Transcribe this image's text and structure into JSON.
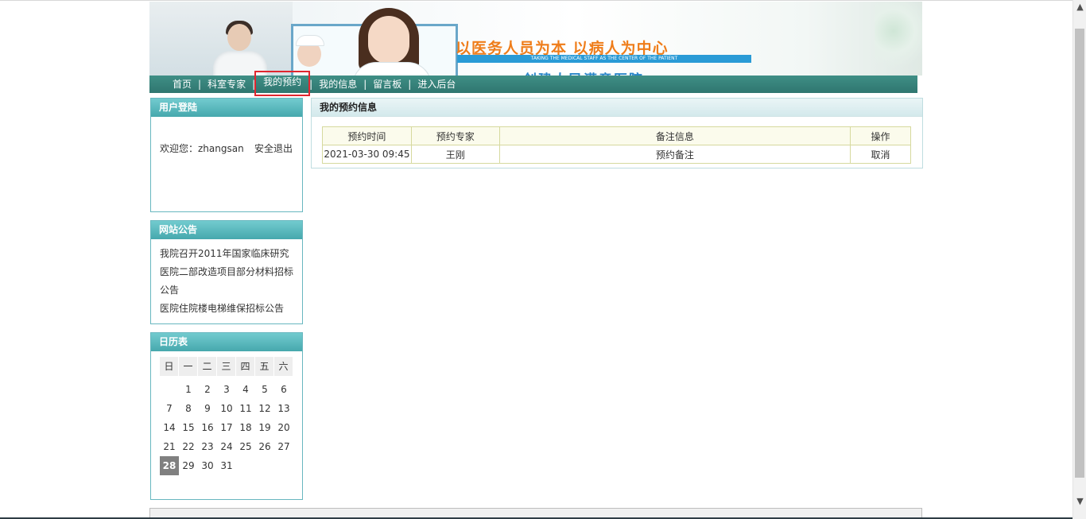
{
  "banner": {
    "slogan": "以医务人员为本 以病人为中心",
    "slogan_en": "TAKING THE MEDICAL STAFF AS THE CENTER OF THE PATIENT",
    "slogan_cut": "创建人民满意医院"
  },
  "nav": {
    "items": [
      {
        "label": "首页"
      },
      {
        "label": "科室专家"
      },
      {
        "label": "我的预约"
      },
      {
        "label": "我的信息"
      },
      {
        "label": "留言板"
      },
      {
        "label": "进入后台"
      }
    ],
    "separator": "|",
    "active_index": 2
  },
  "login": {
    "title": "用户登陆",
    "welcome": "欢迎您：zhangsan",
    "logout": "安全退出"
  },
  "notices": {
    "title": "网站公告",
    "items": [
      "我院召开2011年国家临床研究",
      "医院二部改造项目部分材料招标公告",
      "医院住院楼电梯维保招标公告"
    ]
  },
  "calendar": {
    "title": "日历表",
    "weekdays": [
      "日",
      "一",
      "二",
      "三",
      "四",
      "五",
      "六"
    ],
    "days": [
      "",
      "1",
      "2",
      "3",
      "4",
      "5",
      "6",
      "7",
      "8",
      "9",
      "10",
      "11",
      "12",
      "13",
      "14",
      "15",
      "16",
      "17",
      "18",
      "19",
      "20",
      "21",
      "22",
      "23",
      "24",
      "25",
      "26",
      "27",
      "28",
      "29",
      "30",
      "31",
      "",
      "",
      ""
    ],
    "today": "28"
  },
  "appointments": {
    "title": "我的预约信息",
    "columns": [
      "预约时间",
      "预约专家",
      "备注信息",
      "操作"
    ],
    "rows": [
      {
        "time": "2021-03-30 09:45",
        "expert": "王刚",
        "remark": "预约备注",
        "action": "取消"
      }
    ]
  },
  "colors": {
    "nav_bg": "#3a8780",
    "box_title": "#5bbcc1",
    "active_highlight": "#e0262f",
    "slogan": "#ef7d1a"
  }
}
